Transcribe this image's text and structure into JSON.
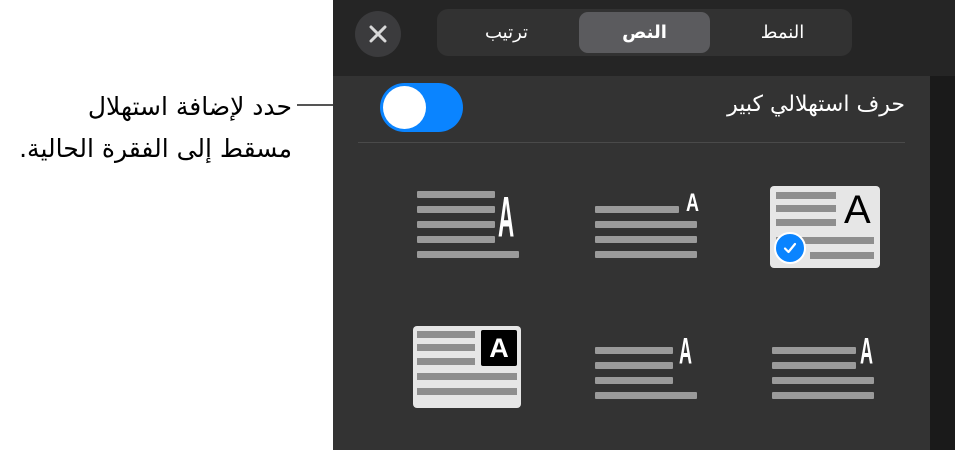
{
  "callout": {
    "line1": "حدد لإضافة استهلال",
    "line2": "مسقط إلى الفقرة الحالية."
  },
  "header": {
    "tabs": [
      {
        "label": "النمط",
        "selected": false
      },
      {
        "label": "النص",
        "selected": true
      },
      {
        "label": "ترتيب",
        "selected": false
      }
    ],
    "close_icon": "close-icon"
  },
  "dropcap": {
    "label": "حرف استهلالي كبير",
    "enabled": true
  },
  "styles": {
    "glyph": "A",
    "selected_index": 0,
    "selected_icon": "checkmark-icon"
  },
  "colors": {
    "accent": "#0a84ff",
    "panel_bg": "#333333",
    "header_bg": "#252525"
  }
}
